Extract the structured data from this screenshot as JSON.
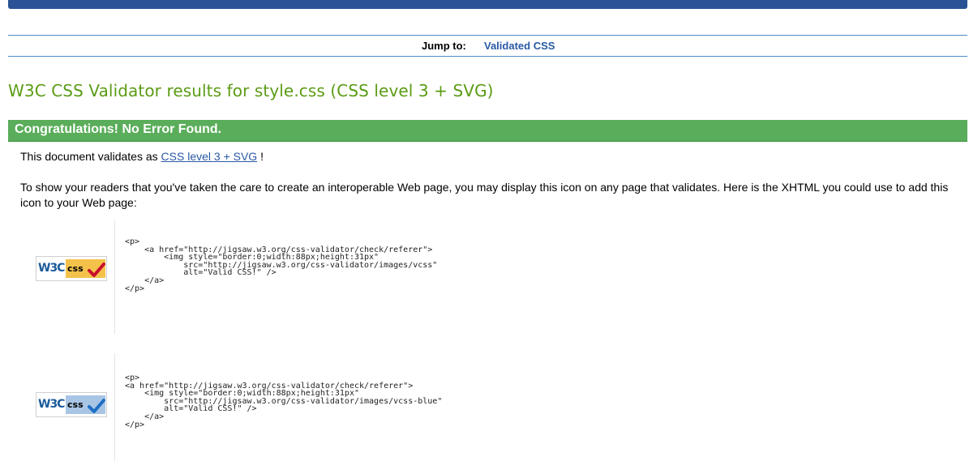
{
  "header": {
    "bar_color": "#2a5294"
  },
  "nav": {
    "jump_label": "Jump to:",
    "jump_link": "Validated CSS",
    "link_color": "#2a5aa5"
  },
  "title": "W3C CSS Validator results for style.css (CSS level 3 + SVG)",
  "congrats": {
    "text": "Congratulations! No Error Found.",
    "color": "#5aad5a"
  },
  "validates": {
    "prefix": "This document validates as",
    "link": "CSS level 3 + SVG",
    "suffix": "!"
  },
  "intro": "To show your readers that you've taken the care to create an interoperable Web page, you may display this icon on any page that validates. Here is the XHTML you could use to add this icon to your Web page:",
  "badges": [
    {
      "icon": "w3c-css-gold-badge",
      "w3c_text": "W3C",
      "css_text": "css",
      "code": "<p>\n    <a href=\"http://jigsaw.w3.org/css-validator/check/referer\">\n        <img style=\"border:0;width:88px;height:31px\"\n            src=\"http://jigsaw.w3.org/css-validator/images/vcss\"\n            alt=\"Valid CSS!\" />\n    </a>\n</p>"
    },
    {
      "icon": "w3c-css-blue-badge",
      "w3c_text": "W3C",
      "css_text": "css",
      "code": "<p>\n<a href=\"http://jigsaw.w3.org/css-validator/check/referer\">\n    <img style=\"border:0;width:88px;height:31px\"\n        src=\"http://jigsaw.w3.org/css-validator/images/vcss-blue\"\n        alt=\"Valid CSS!\" />\n    </a>\n</p>"
    }
  ]
}
